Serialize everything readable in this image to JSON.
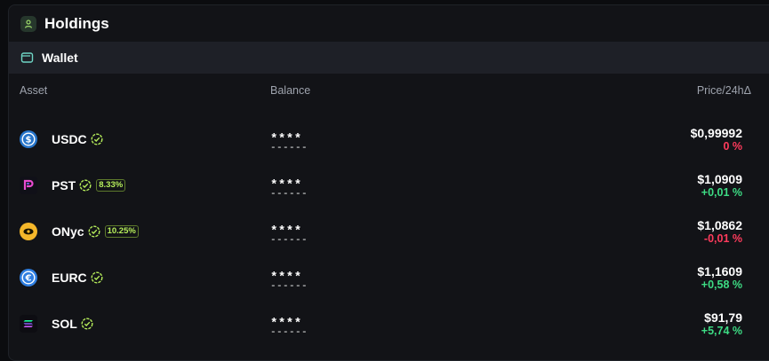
{
  "header": {
    "title": "Holdings",
    "icon": "user-icon"
  },
  "wallet": {
    "title": "Wallet",
    "icon": "wallet-icon"
  },
  "columns": {
    "asset": "Asset",
    "balance": "Balance",
    "price": "Price/24hΔ"
  },
  "colors": {
    "positive": "#3ddc84",
    "negative": "#ff3b5c",
    "verified": "#b7ef5b",
    "accent_icon": "#26372c"
  },
  "assets": [
    {
      "symbol": "USDC",
      "icon": "usdc-icon",
      "verified": true,
      "badge": "",
      "balance": "****",
      "balance_under": "------",
      "price": "$0,99992",
      "change": "0 %",
      "trend": "negative"
    },
    {
      "symbol": "PST",
      "icon": "pst-icon",
      "verified": true,
      "badge": "8.33%",
      "balance": "****",
      "balance_under": "------",
      "price": "$1,0909",
      "change": "+0,01 %",
      "trend": "positive"
    },
    {
      "symbol": "ONyc",
      "icon": "onyc-icon",
      "verified": true,
      "badge": "10.25%",
      "balance": "****",
      "balance_under": "------",
      "price": "$1,0862",
      "change": "-0,01 %",
      "trend": "negative"
    },
    {
      "symbol": "EURC",
      "icon": "eurc-icon",
      "verified": true,
      "badge": "",
      "balance": "****",
      "balance_under": "------",
      "price": "$1,1609",
      "change": "+0,58 %",
      "trend": "positive"
    },
    {
      "symbol": "SOL",
      "icon": "sol-icon",
      "verified": true,
      "badge": "",
      "balance": "****",
      "balance_under": "------",
      "price": "$91,79",
      "change": "+5,74 %",
      "trend": "positive"
    }
  ]
}
